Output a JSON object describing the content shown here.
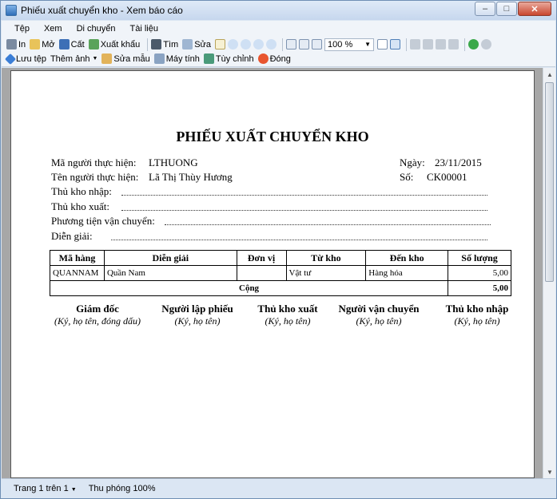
{
  "window": {
    "title": "Phiếu xuất chuyển kho - Xem báo cáo"
  },
  "menu": [
    "Tệp",
    "Xem",
    "Di chuyển",
    "Tài liệu"
  ],
  "toolbar1": {
    "print": "In",
    "open": "Mở",
    "save": "Cất",
    "export": "Xuất khẩu",
    "find": "Tìm",
    "edit": "Sửa",
    "zoom_value": "100 %"
  },
  "toolbar2": {
    "save_file": "Lưu tệp",
    "add_image": "Thêm ảnh",
    "edit_template": "Sửa mẫu",
    "calculator": "Máy tính",
    "customize": "Tùy chỉnh",
    "close": "Đóng"
  },
  "report": {
    "title": "PHIẾU XUẤT CHUYỂN KHO",
    "performer_code_label": "Mã người thực hiện:",
    "performer_code": "LTHUONG",
    "performer_name_label": "Tên người thực hiện:",
    "performer_name": "Lã Thị Thùy Hương",
    "date_label": "Ngày:",
    "date": "23/11/2015",
    "number_label": "Số:",
    "number": "CK00001",
    "receive_keeper_label": "Thủ kho nhập:",
    "issue_keeper_label": "Thủ kho xuất:",
    "transport_label": "Phương tiện vận chuyển:",
    "description_label": "Diễn giải:",
    "table": {
      "headers": [
        "Mã hàng",
        "Diễn giải",
        "Đơn vị",
        "Từ kho",
        "Đến kho",
        "Số lượng"
      ],
      "rows": [
        {
          "code": "QUANNAM",
          "desc": "Quần Nam",
          "unit": "",
          "from": "Vật tư",
          "to": "Hàng hóa",
          "qty": "5,00"
        }
      ],
      "total_label": "Cộng",
      "total_qty": "5,00"
    },
    "signatures": [
      {
        "title": "Giám đốc",
        "note": "(Ký, họ tên, đóng dấu)"
      },
      {
        "title": "Người lập phiếu",
        "note": "(Ký, họ tên)"
      },
      {
        "title": "Thủ kho xuất",
        "note": "(Ký, họ tên)"
      },
      {
        "title": "Người vận chuyển",
        "note": "(Ký, họ tên)"
      },
      {
        "title": "Thủ kho nhập",
        "note": "(Ký, họ tên)"
      }
    ]
  },
  "status": {
    "page": "Trang 1 trên 1",
    "zoom": "Thu phóng 100%"
  }
}
